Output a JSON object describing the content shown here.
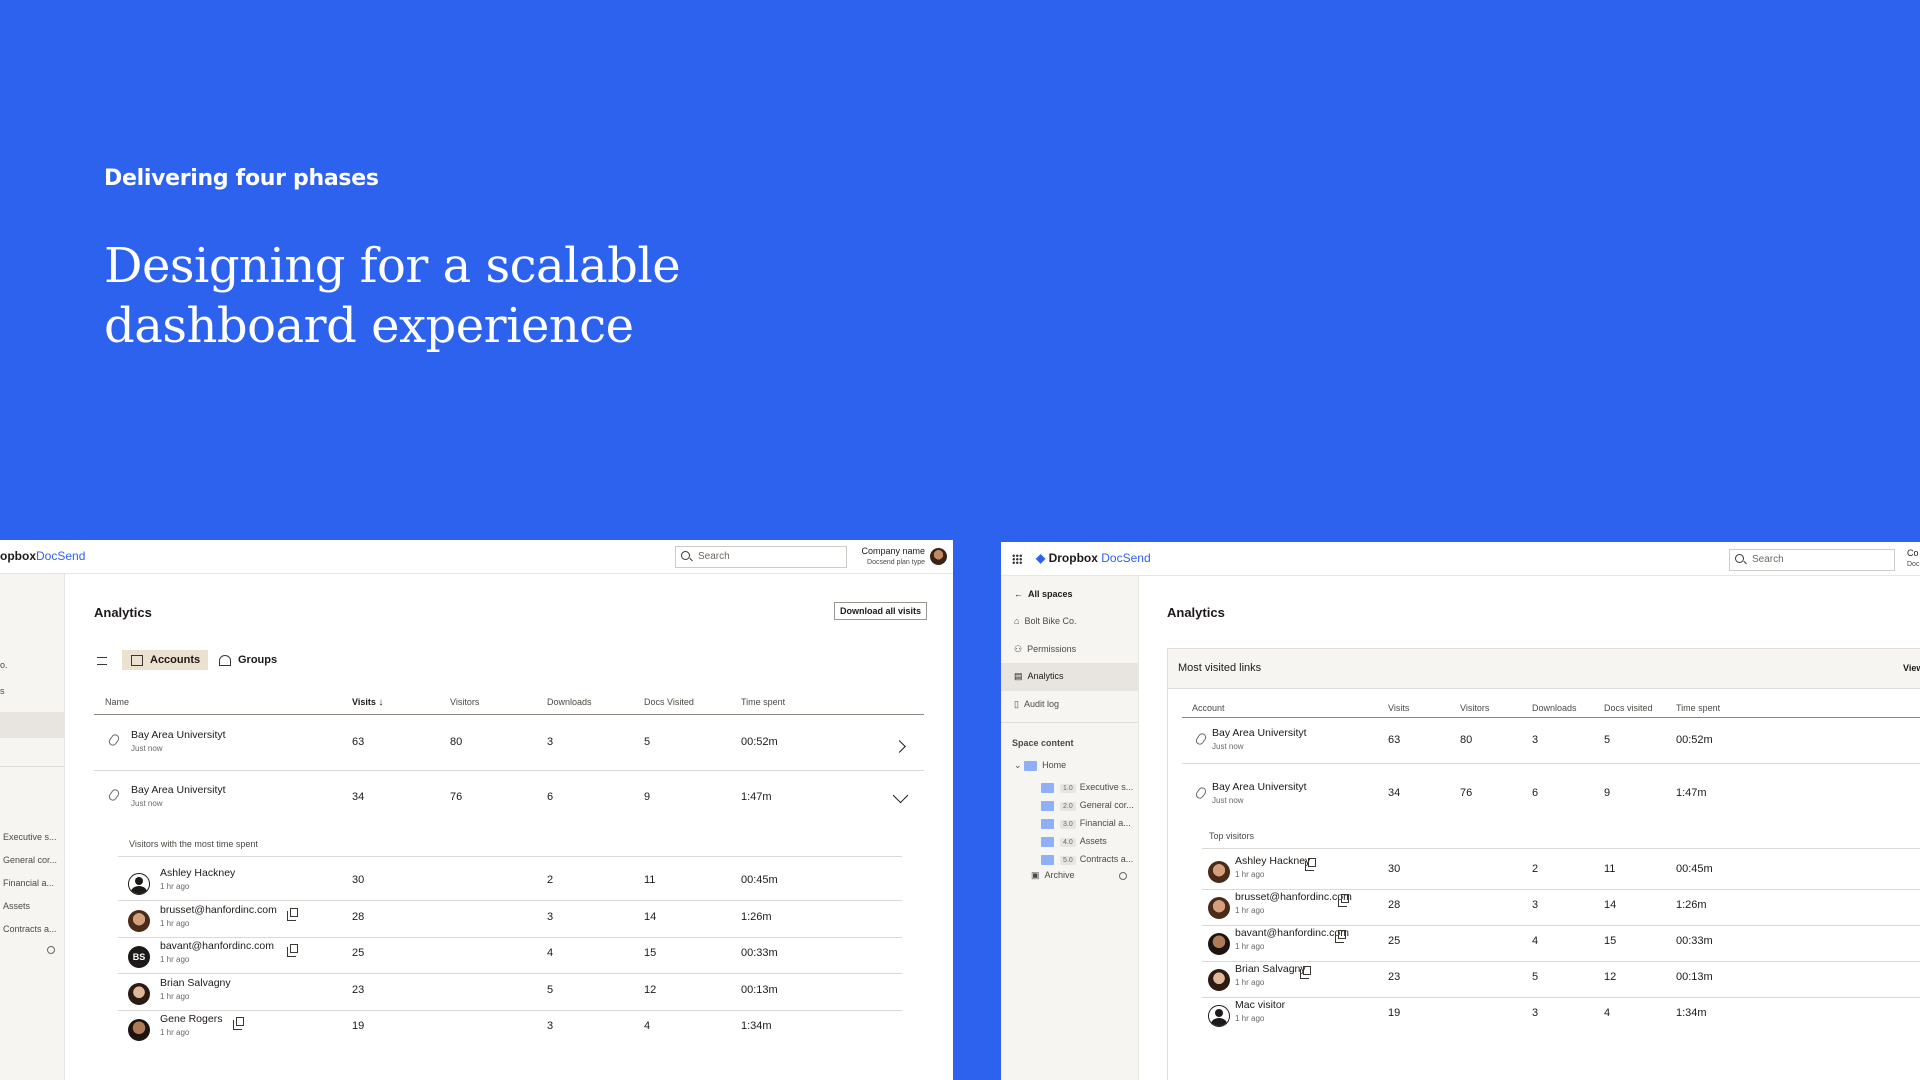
{
  "hero": {
    "eyebrow": "Delivering four phases",
    "headline": "Designing for a scalable dashboard experience"
  },
  "colors": {
    "background": "#2D62EE",
    "accent": "#2D62EE",
    "tab_active": "#EAE1CF"
  },
  "left_panel": {
    "brand_prefix": "opbox",
    "brand_suffix": "DocSend",
    "search_placeholder": "Search",
    "company_name": "Company name",
    "plan_type": "Docsend plan type",
    "sidebar_fragments": [
      "o.",
      "s",
      "Executive s...",
      "General cor...",
      "Financial a...",
      "Assets",
      "Contracts a..."
    ],
    "title": "Analytics",
    "download_button": "Download all visits",
    "tabs": [
      {
        "label": "Accounts",
        "active": true
      },
      {
        "label": "Groups",
        "active": false
      }
    ],
    "columns": [
      "Name",
      "Visits",
      "Visitors",
      "Downloads",
      "Docs Visited",
      "Time spent"
    ],
    "rows": [
      {
        "name": "Bay Area Universityt",
        "sub": "Just now",
        "visits": "63",
        "visitors": "80",
        "downloads": "3",
        "docs": "5",
        "time": "00:52m"
      },
      {
        "name": "Bay Area Universityt",
        "sub": "Just now",
        "visits": "34",
        "visitors": "76",
        "downloads": "6",
        "docs": "9",
        "time": "1:47m"
      }
    ],
    "visitors_label": "Visitors with the most time spent",
    "visitors": [
      {
        "name": "Ashley Hackney",
        "sub": "1 hr ago",
        "visits": "30",
        "downloads": "2",
        "docs": "11",
        "time": "00:45m",
        "avatar": "person"
      },
      {
        "name": "brusset@hanfordinc.com",
        "sub": "1 hr ago",
        "visits": "28",
        "downloads": "3",
        "docs": "14",
        "time": "1:26m",
        "avatar": "photo"
      },
      {
        "name": "bavant@hanfordinc.com",
        "sub": "1 hr ago",
        "visits": "25",
        "downloads": "4",
        "docs": "15",
        "time": "00:33m",
        "avatar": "BS"
      },
      {
        "name": "Brian Salvagny",
        "sub": "1 hr ago",
        "visits": "23",
        "downloads": "5",
        "docs": "12",
        "time": "00:13m",
        "avatar": "photo2"
      },
      {
        "name": "Gene Rogers",
        "sub": "1 hr ago",
        "visits": "19",
        "downloads": "3",
        "docs": "4",
        "time": "1:34m",
        "avatar": "photo3"
      }
    ]
  },
  "right_panel": {
    "brand_prefix": "Dropbox",
    "brand_suffix": "DocSend",
    "search_placeholder": "Search",
    "company_fragment": "Co",
    "plan_fragment": "Doc",
    "nav": [
      "All spaces",
      "Bolt Bike Co.",
      "Permissions",
      "Analytics",
      "Audit log"
    ],
    "space_content_label": "Space content",
    "home": "Home",
    "folders": [
      {
        "num": "1.0",
        "label": "Executive s..."
      },
      {
        "num": "2.0",
        "label": "General cor..."
      },
      {
        "num": "3.0",
        "label": "Financial a..."
      },
      {
        "num": "4.0",
        "label": "Assets"
      },
      {
        "num": "5.0",
        "label": "Contracts a..."
      }
    ],
    "archive": "Archive",
    "title": "Analytics",
    "card_title": "Most visited links",
    "card_action": "View",
    "columns": [
      "Account",
      "Visits",
      "Visitors",
      "Downloads",
      "Docs visited",
      "Time spent"
    ],
    "rows": [
      {
        "name": "Bay Area Universityt",
        "sub": "Just now",
        "visits": "63",
        "visitors": "80",
        "downloads": "3",
        "docs": "5",
        "time": "00:52m"
      },
      {
        "name": "Bay Area Universityt",
        "sub": "Just now",
        "visits": "34",
        "visitors": "76",
        "downloads": "6",
        "docs": "9",
        "time": "1:47m"
      }
    ],
    "visitors_label": "Top visitors",
    "visitors": [
      {
        "name": "Ashley Hackney",
        "sub": "1 hr ago",
        "visits": "30",
        "downloads": "2",
        "docs": "11",
        "time": "00:45m"
      },
      {
        "name": "brusset@hanfordinc.com",
        "sub": "1 hr ago",
        "visits": "28",
        "downloads": "3",
        "docs": "14",
        "time": "1:26m"
      },
      {
        "name": "bavant@hanfordinc.com",
        "sub": "1 hr ago",
        "visits": "25",
        "downloads": "4",
        "docs": "15",
        "time": "00:33m"
      },
      {
        "name": "Brian Salvagny",
        "sub": "1 hr ago",
        "visits": "23",
        "downloads": "5",
        "docs": "12",
        "time": "00:13m"
      },
      {
        "name": "Mac visitor",
        "sub": "1 hr ago",
        "visits": "19",
        "downloads": "3",
        "docs": "4",
        "time": "1:34m"
      }
    ]
  }
}
